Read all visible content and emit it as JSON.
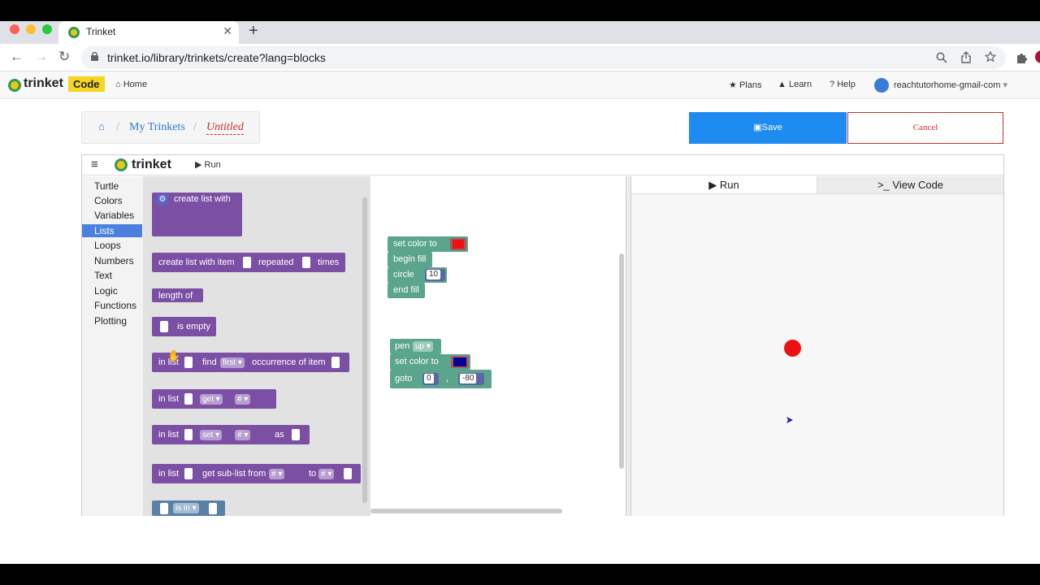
{
  "browser": {
    "tab_title": "Trinket",
    "tab_close": "✕",
    "new_tab": "+",
    "url": "trinket.io/library/trinkets/create?lang=blocks"
  },
  "site": {
    "brand": "trinket",
    "code_badge": "Code",
    "home": "Home",
    "plans": "Plans",
    "learn": "Learn",
    "help": "Help",
    "user": "reachtutorhome-gmail-com"
  },
  "breadcrumb": {
    "my_trinkets": "My Trinkets",
    "separator": "/",
    "current": "Untitled"
  },
  "actions": {
    "save": "Save",
    "cancel": "Cancel"
  },
  "editor": {
    "menu_icon": "≡",
    "brand": "trinket",
    "run_label": "Run",
    "categories": [
      "Turtle",
      "Colors",
      "Variables",
      "Lists",
      "Loops",
      "Numbers",
      "Text",
      "Logic",
      "Functions",
      "Plotting"
    ],
    "selected_category": "Lists"
  },
  "flyout": {
    "create_list_with": "create list with",
    "create_list_with_item": "create list with item",
    "repeated": "repeated",
    "times": "times",
    "length_of": "length of",
    "is_empty": "is empty",
    "in_list": "in list",
    "find": "find",
    "first": "first",
    "occurrence_of_item": "occurrence of item",
    "get": "get",
    "set": "set",
    "as": "as",
    "hash": "#",
    "get_sub_list_from": "get sub-list from",
    "to": "to",
    "is_in": "is in"
  },
  "workspace": {
    "set_color_to": "set color to",
    "begin_fill": "begin fill",
    "circle": "circle",
    "circle_value": "10",
    "end_fill": "end fill",
    "pen": "pen",
    "pen_value": "up",
    "set_color_to_2": "set color to",
    "goto": "goto",
    "goto_x": "0",
    "goto_comma": ",",
    "goto_y": "-80",
    "color1": "#ee1111",
    "color2": "#000099"
  },
  "output": {
    "run_tab": "Run",
    "view_code_tab": "View Code",
    "dot_color": "#ee1111",
    "turtle_color": "#1a1aa0"
  }
}
